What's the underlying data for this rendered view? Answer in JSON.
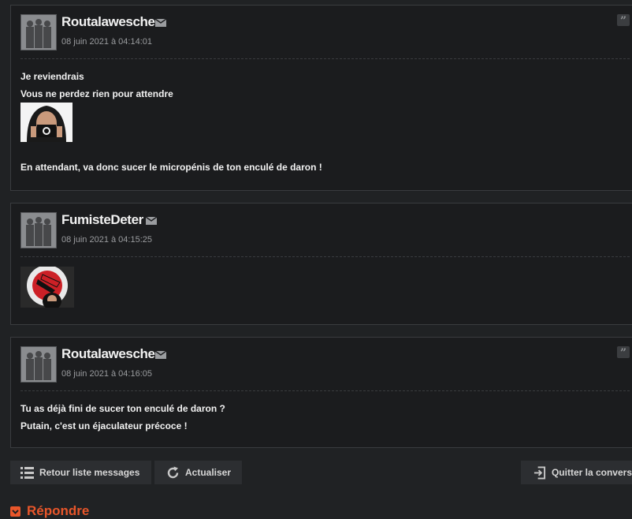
{
  "posts": [
    {
      "author": "Routalawesche",
      "date": "08 juin 2021 à 04:14:01",
      "lines": [
        "Je reviendrais",
        "Vous ne perdez rien pour attendre"
      ],
      "after_image": "En attendant, va donc sucer le micropénis de ton enculé de daron !",
      "has_quote": true
    },
    {
      "author": "FumisteDeter",
      "date": "08 juin 2021 à 04:15:25",
      "has_quote": false
    },
    {
      "author": "Routalawesche",
      "date": "08 juin 2021 à 04:16:05",
      "lines": [
        "Tu as déjà fini de sucer ton enculé de daron ?",
        "Putain, c'est un éjaculateur précoce !"
      ],
      "has_quote": true
    }
  ],
  "toolbar": {
    "back_label": "Retour liste messages",
    "refresh_label": "Actualiser",
    "quit_label": "Quitter la convers"
  },
  "reply": {
    "label": "Répondre"
  },
  "quote_glyph": "”",
  "colors": {
    "accent": "#e8562a",
    "panel": "#1b1c1e",
    "border": "#3a3c3f"
  }
}
